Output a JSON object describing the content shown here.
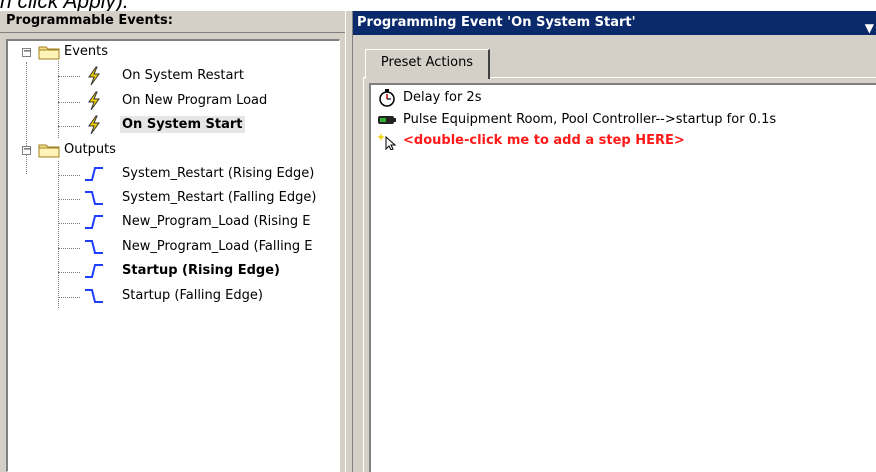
{
  "caption": "n click Apply).",
  "left_panel": {
    "header": "Programmable Events:",
    "tree": {
      "events_folder": "Events",
      "events": [
        "On System Restart",
        "On New Program Load",
        "On System Start"
      ],
      "outputs_folder": "Outputs",
      "outputs": [
        "System_Restart (Rising Edge)",
        "System_Restart (Falling Edge)",
        "New_Program_Load (Rising E",
        "New_Program_Load (Falling E",
        "Startup (Rising Edge)",
        "Startup (Falling Edge)"
      ]
    }
  },
  "right_panel": {
    "title": "Programming Event 'On System Start'",
    "tab": "Preset Actions",
    "actions": [
      {
        "icon": "stopwatch-icon",
        "text": "Delay for 2s"
      },
      {
        "icon": "battery-icon",
        "text": "Pulse Equipment Room, Pool Controller-->startup for 0.1s"
      }
    ],
    "add_step": "<double-click me to add a step HERE>"
  },
  "colors": {
    "title_bar": "#0b2a6b",
    "add_step": "#ff1a1a",
    "edge_icon": "#1f3fff",
    "bolt_icon": "#e0c000"
  }
}
